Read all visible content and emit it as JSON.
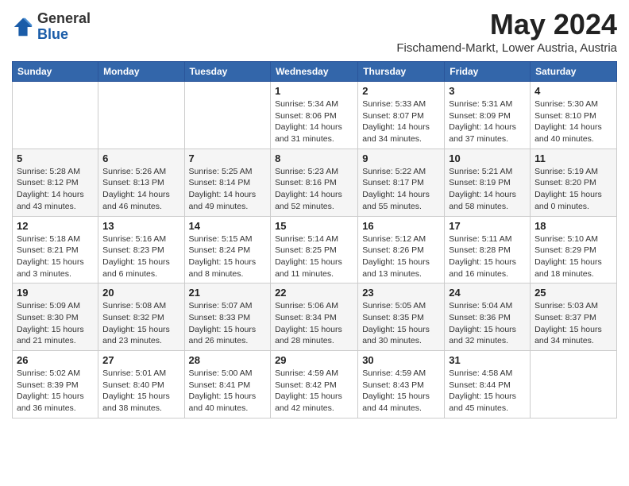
{
  "header": {
    "logo_general": "General",
    "logo_blue": "Blue",
    "month_title": "May 2024",
    "location": "Fischamend-Markt, Lower Austria, Austria"
  },
  "weekdays": [
    "Sunday",
    "Monday",
    "Tuesday",
    "Wednesday",
    "Thursday",
    "Friday",
    "Saturday"
  ],
  "weeks": [
    [
      {
        "day": "",
        "info": ""
      },
      {
        "day": "",
        "info": ""
      },
      {
        "day": "",
        "info": ""
      },
      {
        "day": "1",
        "info": "Sunrise: 5:34 AM\nSunset: 8:06 PM\nDaylight: 14 hours\nand 31 minutes."
      },
      {
        "day": "2",
        "info": "Sunrise: 5:33 AM\nSunset: 8:07 PM\nDaylight: 14 hours\nand 34 minutes."
      },
      {
        "day": "3",
        "info": "Sunrise: 5:31 AM\nSunset: 8:09 PM\nDaylight: 14 hours\nand 37 minutes."
      },
      {
        "day": "4",
        "info": "Sunrise: 5:30 AM\nSunset: 8:10 PM\nDaylight: 14 hours\nand 40 minutes."
      }
    ],
    [
      {
        "day": "5",
        "info": "Sunrise: 5:28 AM\nSunset: 8:12 PM\nDaylight: 14 hours\nand 43 minutes."
      },
      {
        "day": "6",
        "info": "Sunrise: 5:26 AM\nSunset: 8:13 PM\nDaylight: 14 hours\nand 46 minutes."
      },
      {
        "day": "7",
        "info": "Sunrise: 5:25 AM\nSunset: 8:14 PM\nDaylight: 14 hours\nand 49 minutes."
      },
      {
        "day": "8",
        "info": "Sunrise: 5:23 AM\nSunset: 8:16 PM\nDaylight: 14 hours\nand 52 minutes."
      },
      {
        "day": "9",
        "info": "Sunrise: 5:22 AM\nSunset: 8:17 PM\nDaylight: 14 hours\nand 55 minutes."
      },
      {
        "day": "10",
        "info": "Sunrise: 5:21 AM\nSunset: 8:19 PM\nDaylight: 14 hours\nand 58 minutes."
      },
      {
        "day": "11",
        "info": "Sunrise: 5:19 AM\nSunset: 8:20 PM\nDaylight: 15 hours\nand 0 minutes."
      }
    ],
    [
      {
        "day": "12",
        "info": "Sunrise: 5:18 AM\nSunset: 8:21 PM\nDaylight: 15 hours\nand 3 minutes."
      },
      {
        "day": "13",
        "info": "Sunrise: 5:16 AM\nSunset: 8:23 PM\nDaylight: 15 hours\nand 6 minutes."
      },
      {
        "day": "14",
        "info": "Sunrise: 5:15 AM\nSunset: 8:24 PM\nDaylight: 15 hours\nand 8 minutes."
      },
      {
        "day": "15",
        "info": "Sunrise: 5:14 AM\nSunset: 8:25 PM\nDaylight: 15 hours\nand 11 minutes."
      },
      {
        "day": "16",
        "info": "Sunrise: 5:12 AM\nSunset: 8:26 PM\nDaylight: 15 hours\nand 13 minutes."
      },
      {
        "day": "17",
        "info": "Sunrise: 5:11 AM\nSunset: 8:28 PM\nDaylight: 15 hours\nand 16 minutes."
      },
      {
        "day": "18",
        "info": "Sunrise: 5:10 AM\nSunset: 8:29 PM\nDaylight: 15 hours\nand 18 minutes."
      }
    ],
    [
      {
        "day": "19",
        "info": "Sunrise: 5:09 AM\nSunset: 8:30 PM\nDaylight: 15 hours\nand 21 minutes."
      },
      {
        "day": "20",
        "info": "Sunrise: 5:08 AM\nSunset: 8:32 PM\nDaylight: 15 hours\nand 23 minutes."
      },
      {
        "day": "21",
        "info": "Sunrise: 5:07 AM\nSunset: 8:33 PM\nDaylight: 15 hours\nand 26 minutes."
      },
      {
        "day": "22",
        "info": "Sunrise: 5:06 AM\nSunset: 8:34 PM\nDaylight: 15 hours\nand 28 minutes."
      },
      {
        "day": "23",
        "info": "Sunrise: 5:05 AM\nSunset: 8:35 PM\nDaylight: 15 hours\nand 30 minutes."
      },
      {
        "day": "24",
        "info": "Sunrise: 5:04 AM\nSunset: 8:36 PM\nDaylight: 15 hours\nand 32 minutes."
      },
      {
        "day": "25",
        "info": "Sunrise: 5:03 AM\nSunset: 8:37 PM\nDaylight: 15 hours\nand 34 minutes."
      }
    ],
    [
      {
        "day": "26",
        "info": "Sunrise: 5:02 AM\nSunset: 8:39 PM\nDaylight: 15 hours\nand 36 minutes."
      },
      {
        "day": "27",
        "info": "Sunrise: 5:01 AM\nSunset: 8:40 PM\nDaylight: 15 hours\nand 38 minutes."
      },
      {
        "day": "28",
        "info": "Sunrise: 5:00 AM\nSunset: 8:41 PM\nDaylight: 15 hours\nand 40 minutes."
      },
      {
        "day": "29",
        "info": "Sunrise: 4:59 AM\nSunset: 8:42 PM\nDaylight: 15 hours\nand 42 minutes."
      },
      {
        "day": "30",
        "info": "Sunrise: 4:59 AM\nSunset: 8:43 PM\nDaylight: 15 hours\nand 44 minutes."
      },
      {
        "day": "31",
        "info": "Sunrise: 4:58 AM\nSunset: 8:44 PM\nDaylight: 15 hours\nand 45 minutes."
      },
      {
        "day": "",
        "info": ""
      }
    ]
  ]
}
